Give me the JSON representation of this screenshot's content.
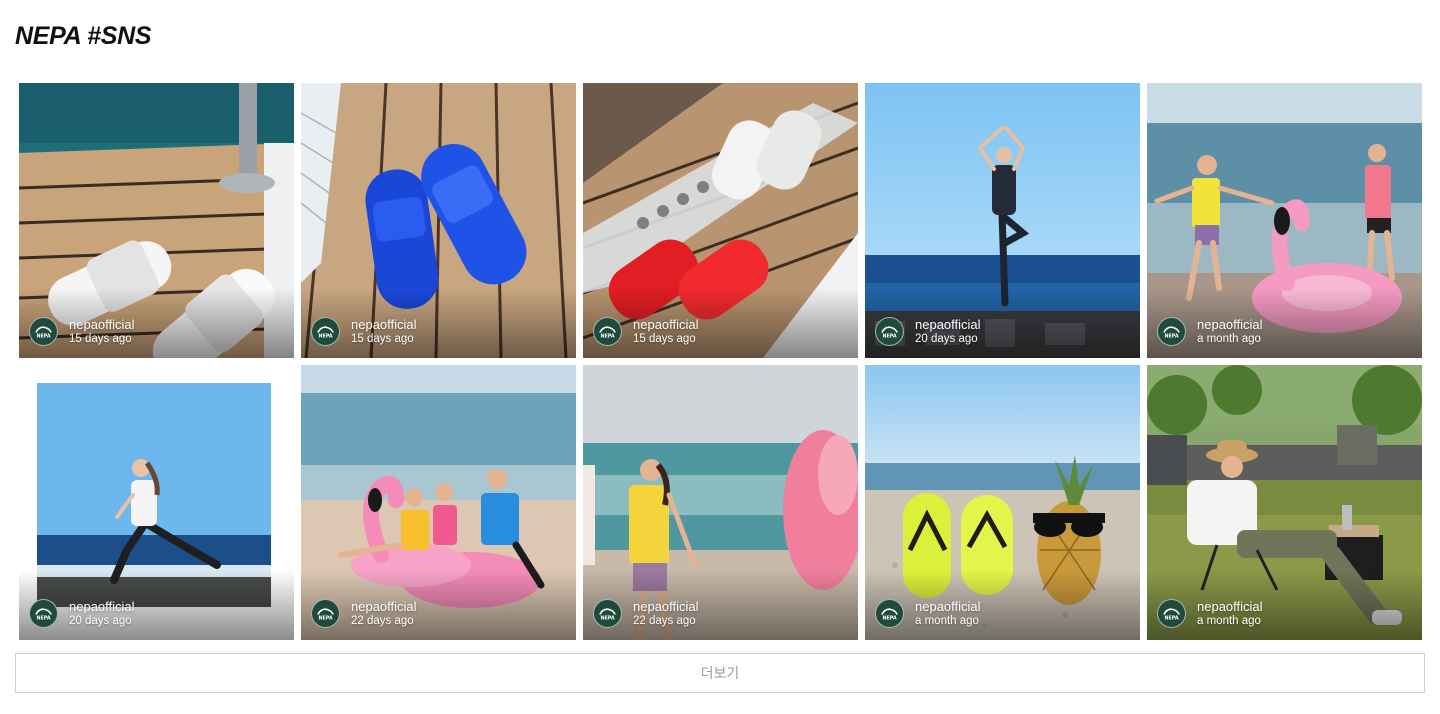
{
  "page": {
    "title": "NEPA #SNS",
    "more_label": "더보기"
  },
  "colors": {
    "avatar_bg": "#1f4a3c",
    "button_border": "#cfcfcf",
    "button_text": "#9a9a9a"
  },
  "posts": [
    {
      "user": "nepaofficial",
      "ago": "15 days ago",
      "photo": "white-slides-on-deck"
    },
    {
      "user": "nepaofficial",
      "ago": "15 days ago",
      "photo": "blue-slides-on-deck"
    },
    {
      "user": "nepaofficial",
      "ago": "15 days ago",
      "photo": "white-and-red-slides-on-deck"
    },
    {
      "user": "nepaofficial",
      "ago": "20 days ago",
      "photo": "yoga-tree-pose-seaside"
    },
    {
      "user": "nepaofficial",
      "ago": "a month ago",
      "photo": "beach-with-pink-flamingo-float"
    },
    {
      "user": "nepaofficial",
      "ago": "20 days ago",
      "photo": "lunge-pose-seaside"
    },
    {
      "user": "nepaofficial",
      "ago": "22 days ago",
      "photo": "group-on-flamingo-float"
    },
    {
      "user": "nepaofficial",
      "ago": "22 days ago",
      "photo": "walking-on-beach-with-float"
    },
    {
      "user": "nepaofficial",
      "ago": "a month ago",
      "photo": "flip-flops-and-pineapple-on-sand"
    },
    {
      "user": "nepaofficial",
      "ago": "a month ago",
      "photo": "camping-chair-outdoors"
    }
  ]
}
